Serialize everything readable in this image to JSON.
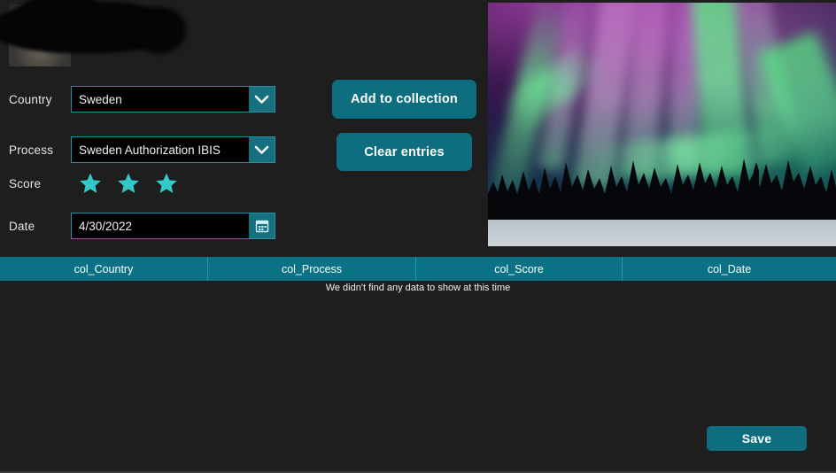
{
  "theme": {
    "background": "#1e1e1e",
    "accent_teal": "#0e6e80",
    "header_teal": "#0b7185",
    "input_border": "#2a8f9e",
    "star_color": "#35c8c8",
    "text": "#e6e6e6"
  },
  "avatar": {
    "name": "profile-thumbnail",
    "redacted": "true"
  },
  "form": {
    "country": {
      "label": "Country",
      "value": "Sweden",
      "dropdown_icon": "chevron-down-icon"
    },
    "process": {
      "label": "Process",
      "value": "Sweden Authorization IBIS",
      "dropdown_icon": "chevron-down-icon"
    },
    "score": {
      "label": "Score",
      "value": 3,
      "max": 5,
      "filled_count": 3,
      "star_icon": "star-icon"
    },
    "date": {
      "label": "Date",
      "value": "4/30/2022",
      "picker_icon": "calendar-icon"
    }
  },
  "actions": {
    "add_to_collection": "Add to collection",
    "clear_entries": "Clear entries",
    "save": "Save"
  },
  "preview_image": {
    "name": "aurora-borealis-photo",
    "alt": "Aurora borealis over a snowy forest"
  },
  "table": {
    "columns": [
      {
        "label": "col_Country"
      },
      {
        "label": "col_Process"
      },
      {
        "label": "col_Score"
      },
      {
        "label": "col_Date"
      }
    ],
    "rows": [],
    "empty_message": "We didn't find any data to show at this time"
  }
}
